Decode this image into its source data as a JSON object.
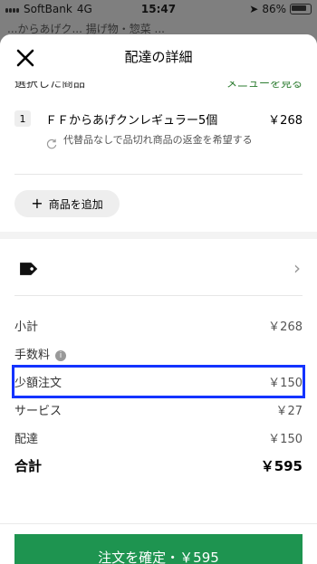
{
  "status_bar": {
    "carrier": "SoftBank",
    "network": "4G",
    "time": "15:47",
    "battery": "86%"
  },
  "background_header": {
    "text": "...からあげク... 揚げ物・惣菜 ..."
  },
  "sheet": {
    "title": "配達の詳細",
    "section_title": "選択した商品",
    "menu_link": "メニューを見る",
    "item": {
      "qty": "1",
      "name": "ＦＦからあげクンレギュラー5個",
      "price": "￥268",
      "substitution_note": "代替品なしで品切れ商品の返金を希望する"
    },
    "add_button": "商品を追加",
    "fees": [
      {
        "label": "小計",
        "value": "￥268"
      },
      {
        "label": "手数料",
        "value": "",
        "has_info": true
      },
      {
        "label": "少額注文",
        "value": "￥150",
        "highlighted": true
      },
      {
        "label": "サービス",
        "value": "￥27"
      },
      {
        "label": "配達",
        "value": "￥150"
      }
    ],
    "total": {
      "label": "合計",
      "value": "￥595"
    },
    "cta": "注文を確定・￥595"
  },
  "colors": {
    "brand_green": "#1e9450",
    "highlight_blue": "#1433ff"
  },
  "icons": [
    "close-icon",
    "refresh-icon",
    "tag-icon",
    "chevron-right-icon",
    "info-icon",
    "plus-icon"
  ]
}
